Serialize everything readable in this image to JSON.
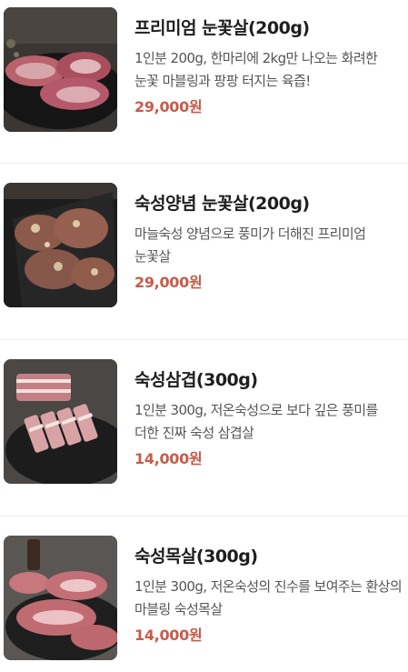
{
  "colors": {
    "price": "#c75b4a",
    "name": "#1e1e1e",
    "description": "#555555",
    "divider": "#ececec"
  },
  "products": [
    {
      "name": "프리미엄 눈꽃살(200g)",
      "description": "1인분 200g, 한마리에 2kg만 나오는 화려한 눈꽃 마블링과 팡팡 터지는 육즙!",
      "price": "29,000원",
      "image_icon": "beef-snowflake-image"
    },
    {
      "name": "숙성양념 눈꽃살(200g)",
      "description": "마늘숙성 양념으로 풍미가 더해진 프리미엄 눈꽃살",
      "price": "29,000원",
      "image_icon": "marinated-beef-image"
    },
    {
      "name": "숙성삼겹(300g)",
      "description": "1인분 300g, 저온숙성으로 보다 깊은 풍미를 더한 진짜 숙성 삼겹살",
      "price": "14,000원",
      "image_icon": "pork-belly-image"
    },
    {
      "name": "숙성목살(300g)",
      "description": "1인분 300g, 저온숙성의 진수를 보여주는 환상의 마블링 숙성목살",
      "price": "14,000원",
      "image_icon": "pork-neck-image"
    }
  ]
}
